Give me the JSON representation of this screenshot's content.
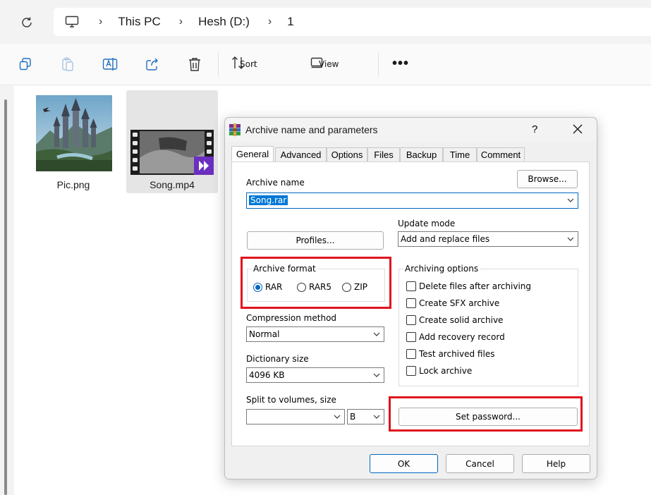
{
  "explorer": {
    "breadcrumb": [
      "This PC",
      "Hesh (D:)",
      "1"
    ],
    "toolbar": {
      "sort_label": "Sort",
      "view_label": "View",
      "more_label": "•••"
    },
    "files": [
      {
        "name": "Pic.png"
      },
      {
        "name": "Song.mp4"
      }
    ]
  },
  "dialog": {
    "title": "Archive name and parameters",
    "help_label": "?",
    "tabs": [
      "General",
      "Advanced",
      "Options",
      "Files",
      "Backup",
      "Time",
      "Comment"
    ],
    "active_tab": "General",
    "archive_name_label": "Archive name",
    "archive_name_value": "Song.rar",
    "browse_label": "Browse...",
    "profiles_label": "Profiles...",
    "update_mode_label": "Update mode",
    "update_mode_value": "Add and replace files",
    "archive_format_label": "Archive format",
    "formats": [
      "RAR",
      "RAR5",
      "ZIP"
    ],
    "selected_format": "RAR",
    "compression_label": "Compression method",
    "compression_value": "Normal",
    "dictionary_label": "Dictionary size",
    "dictionary_value": "4096 KB",
    "split_label": "Split to volumes, size",
    "split_value": "",
    "split_unit": "B",
    "archiving_options_label": "Archiving options",
    "options": [
      "Delete files after archiving",
      "Create SFX archive",
      "Create solid archive",
      "Add recovery record",
      "Test archived files",
      "Lock archive"
    ],
    "set_password_label": "Set password...",
    "ok_label": "OK",
    "cancel_label": "Cancel",
    "help_button_label": "Help"
  },
  "colors": {
    "highlight": "#e0141e",
    "accent": "#0067c0",
    "selection": "#0078d7"
  }
}
